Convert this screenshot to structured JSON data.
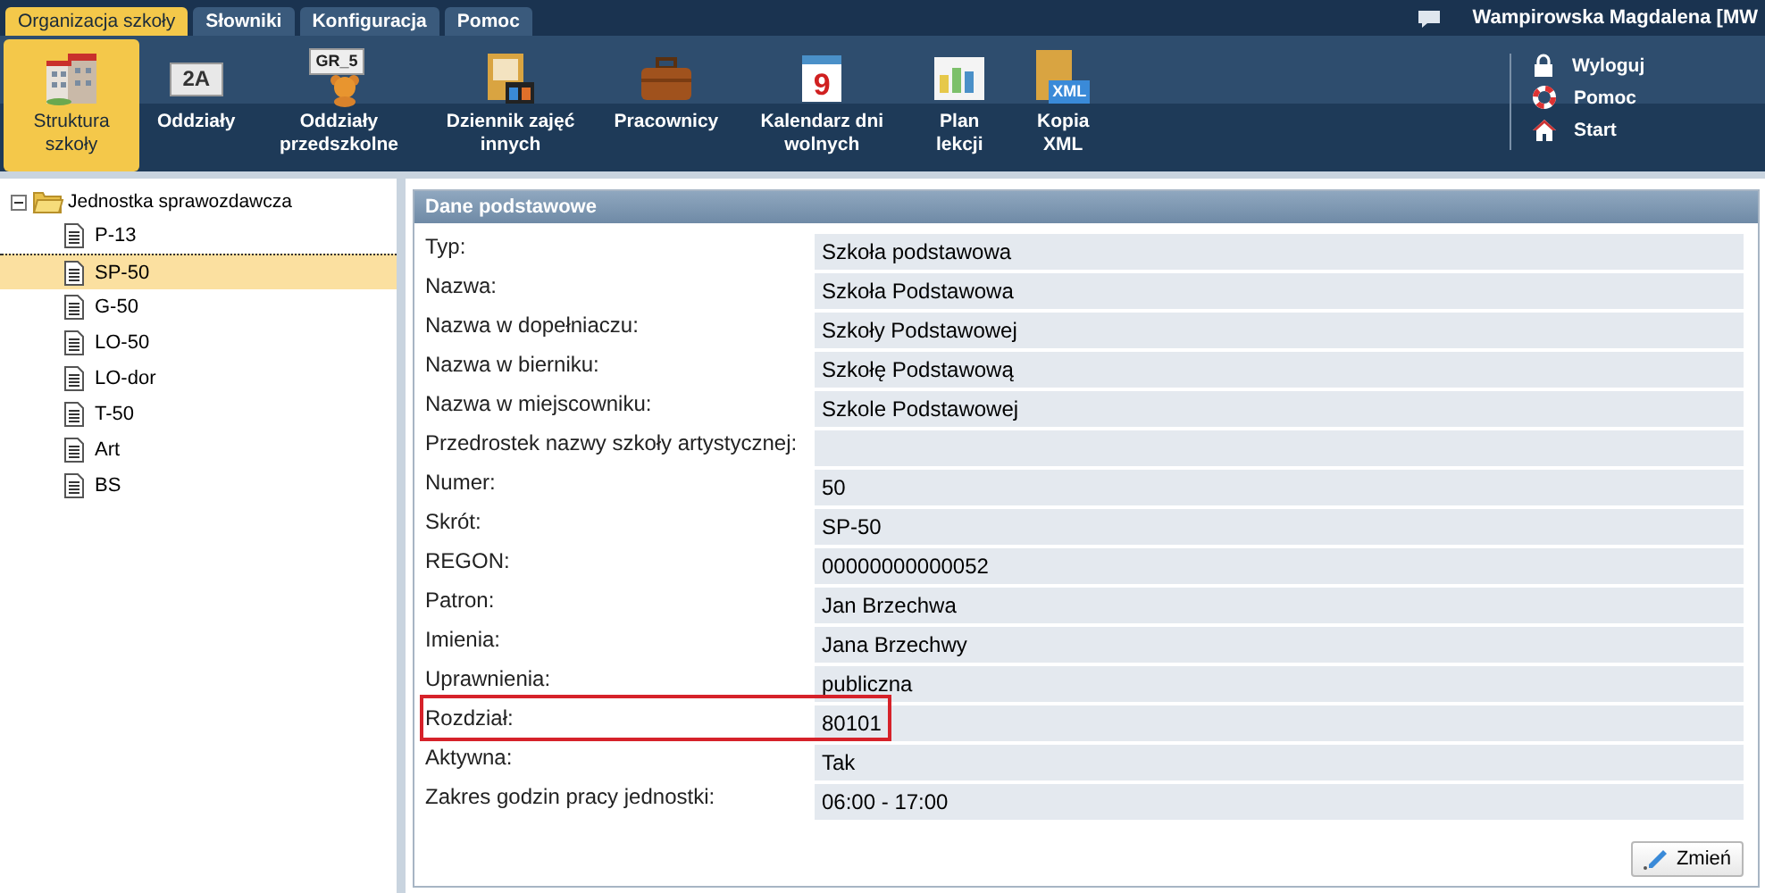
{
  "menu_tabs": [
    {
      "label": "Organizacja szkoły",
      "selected": true
    },
    {
      "label": "Słowniki",
      "selected": false
    },
    {
      "label": "Konfiguracja",
      "selected": false
    },
    {
      "label": "Pomoc",
      "selected": false
    }
  ],
  "user": "Wampirowska Magdalena [MW",
  "toolbar": [
    {
      "label": "Struktura szkoły",
      "selected": true
    },
    {
      "label": "Oddziały",
      "selected": false,
      "icon_text": "2A"
    },
    {
      "label": "Oddziały przedszkolne",
      "selected": false,
      "icon_text": "GR_5"
    },
    {
      "label": "Dziennik zajęć innych",
      "selected": false
    },
    {
      "label": "Pracownicy",
      "selected": false
    },
    {
      "label": "Kalendarz dni wolnych",
      "selected": false,
      "icon_text": "9"
    },
    {
      "label": "Plan lekcji",
      "selected": false
    },
    {
      "label": "Kopia XML",
      "selected": false,
      "icon_text": "XML"
    }
  ],
  "side_links": [
    {
      "label": "Wyloguj",
      "kind": "lock"
    },
    {
      "label": "Pomoc",
      "kind": "help"
    },
    {
      "label": "Start",
      "kind": "home"
    }
  ],
  "tree": {
    "label": "Jednostka sprawozdawcza",
    "expanded": true,
    "children": [
      {
        "label": "P-13",
        "selected": false
      },
      {
        "label": "SP-50",
        "selected": true
      },
      {
        "label": "G-50",
        "selected": false
      },
      {
        "label": "LO-50",
        "selected": false
      },
      {
        "label": "LO-dor",
        "selected": false
      },
      {
        "label": "T-50",
        "selected": false
      },
      {
        "label": "Art",
        "selected": false
      },
      {
        "label": "BS",
        "selected": false
      }
    ]
  },
  "panel": {
    "title": "Dane podstawowe",
    "fields": [
      {
        "label": "Typ:",
        "value": "Szkoła podstawowa",
        "highlighted": false
      },
      {
        "label": "Nazwa:",
        "value": "Szkoła Podstawowa",
        "highlighted": false
      },
      {
        "label": "Nazwa w dopełniaczu:",
        "value": "Szkoły Podstawowej",
        "highlighted": false
      },
      {
        "label": "Nazwa w bierniku:",
        "value": "Szkołę Podstawową",
        "highlighted": false
      },
      {
        "label": "Nazwa w miejscowniku:",
        "value": "Szkole Podstawowej",
        "highlighted": false
      },
      {
        "label": "Przedrostek nazwy szkoły artystycznej:",
        "highlighted": false
      },
      {
        "label": "Numer:",
        "value": "50",
        "highlighted": false
      },
      {
        "label": "Skrót:",
        "value": "SP-50",
        "highlighted": false
      },
      {
        "label": "REGON:",
        "value": "00000000000052",
        "highlighted": false
      },
      {
        "label": "Patron:",
        "value": "Jan Brzechwa",
        "highlighted": false
      },
      {
        "label": "Imienia:",
        "value": "Jana Brzechwy",
        "highlighted": false
      },
      {
        "label": "Uprawnienia:",
        "value": "publiczna",
        "highlighted": false
      },
      {
        "label": "Rozdział:",
        "value": "80101",
        "highlighted": true
      },
      {
        "label": "Aktywna:",
        "value": "Tak",
        "highlighted": false
      },
      {
        "label": "Zakres godzin pracy jednostki:",
        "value": "06:00 - 17:00",
        "highlighted": false
      }
    ],
    "button": "Zmień"
  }
}
